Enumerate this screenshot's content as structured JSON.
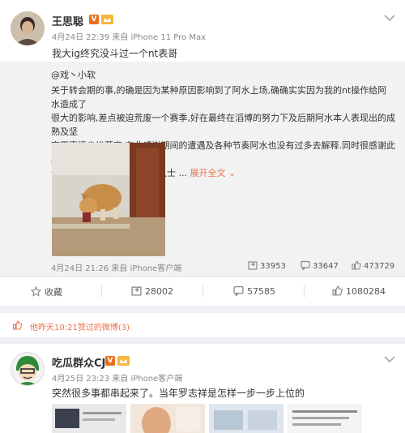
{
  "post1": {
    "author": "王思聪",
    "time": "4月24日 22:39",
    "source": "来自 iPhone 11 Pro Max",
    "text": "我大ig终究没斗过一个nt表哥",
    "repost": {
      "author": "@戏丶小软",
      "body_lines": [
        "关于转会期的事,的确是因为某种原因影响到了阿水上场,确确实实因为我的nt操作给阿水造成了",
        "很大的影响,差点被迫荒废一个赛季,好在最终在滔博的努力下及后期阿水本人表现出的成熟及坚",
        "定下事情尘埃落定.在此感谢期间的遭遇及各种节奏阿水也没有过多去解释.同时很感谢此期间给",
        "予建议指导及帮助的各圈内人士 ..."
      ],
      "more": "展开全文",
      "time": "4月24日 21:26",
      "source": "来自 iPhone客户端",
      "reposts": "33953",
      "comments": "33647",
      "likes": "473729"
    },
    "actions": {
      "favorite": "收藏",
      "repost": "28002",
      "comment": "57585",
      "like": "1080284"
    }
  },
  "collapsed": {
    "text": "他昨天10:21赞过的微博(3)"
  },
  "post2": {
    "author": "吃瓜群众CJ",
    "time": "4月25日 23:23",
    "source": "来自 iPhone客户端",
    "text": "突然很多事都串起来了。当年罗志祥是怎样一步一步上位的"
  },
  "colors": {
    "accent": "#eb7350",
    "vip": "#e8701c"
  }
}
